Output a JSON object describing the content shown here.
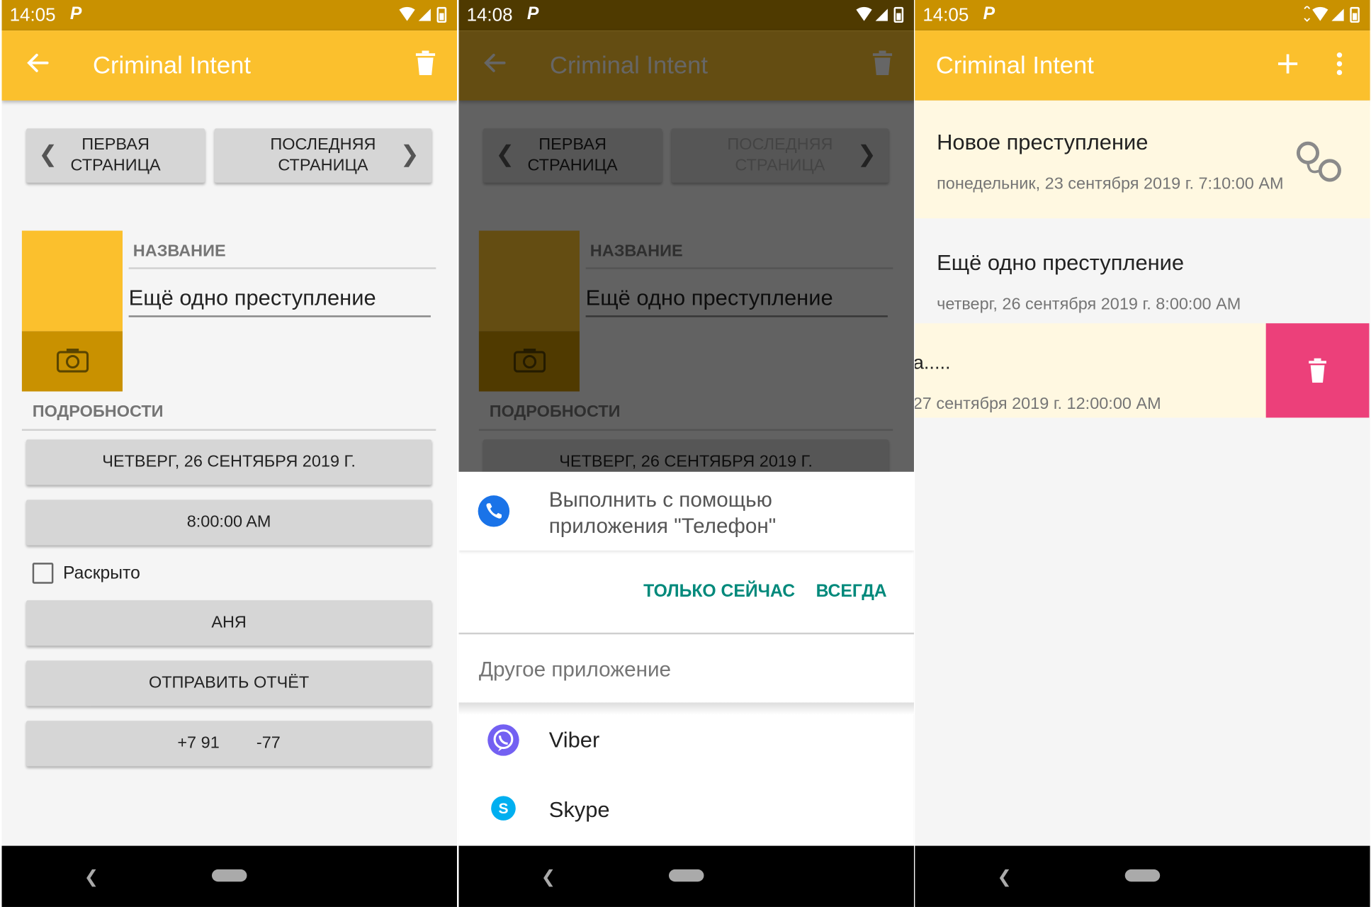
{
  "status_bars": [
    {
      "time": "14:05",
      "carrier": "P"
    },
    {
      "time": "14:08",
      "carrier": "P"
    },
    {
      "time": "14:05",
      "carrier": "P"
    }
  ],
  "app_title": "Criminal Intent",
  "detail": {
    "first_page_line1": "ПЕРВАЯ",
    "first_page_line2": "СТРАНИЦА",
    "last_page_line1": "ПОСЛЕДНЯЯ",
    "last_page_line2": "СТРАНИЦА",
    "title_label": "НАЗВАНИЕ",
    "title_value": "Ещё одно преступление",
    "details_label": "ПОДРОБНОСТИ",
    "date_button": "ЧЕТВЕРГ, 26 СЕНТЯБРЯ 2019 Г.",
    "time_button": "8:00:00 AM",
    "solved_label": "Раскрыто",
    "solved_checked": false,
    "suspect_button": "АНЯ",
    "report_button": "ОТПРАВИТЬ ОТЧЁТ",
    "phone_button": "+7 91        -77"
  },
  "chooser": {
    "title": "Выполнить с помощью приложения \"Телефон\"",
    "just_once": "ТОЛЬКО СЕЙЧАС",
    "always": "ВСЕГДА",
    "other_app": "Другое приложение",
    "apps": [
      "Viber",
      "Skype"
    ]
  },
  "list": {
    "items": [
      {
        "title": "Новое преступление",
        "date": "понедельник, 23 сентября 2019 г. 7:10:00 AM",
        "solved": true
      },
      {
        "title": "Ещё одно преступление",
        "date": "четверг, 26 сентября 2019 г. 8:00:00 AM",
        "solved": false
      },
      {
        "title": "а.....",
        "date": "27 сентября 2019 г. 12:00:00 AM",
        "solved": false
      }
    ]
  },
  "colors": {
    "status_bar": "#c99100",
    "toolbar": "#fbc02d",
    "accent_teal": "#00897b",
    "swipe_delete": "#ec407a"
  }
}
